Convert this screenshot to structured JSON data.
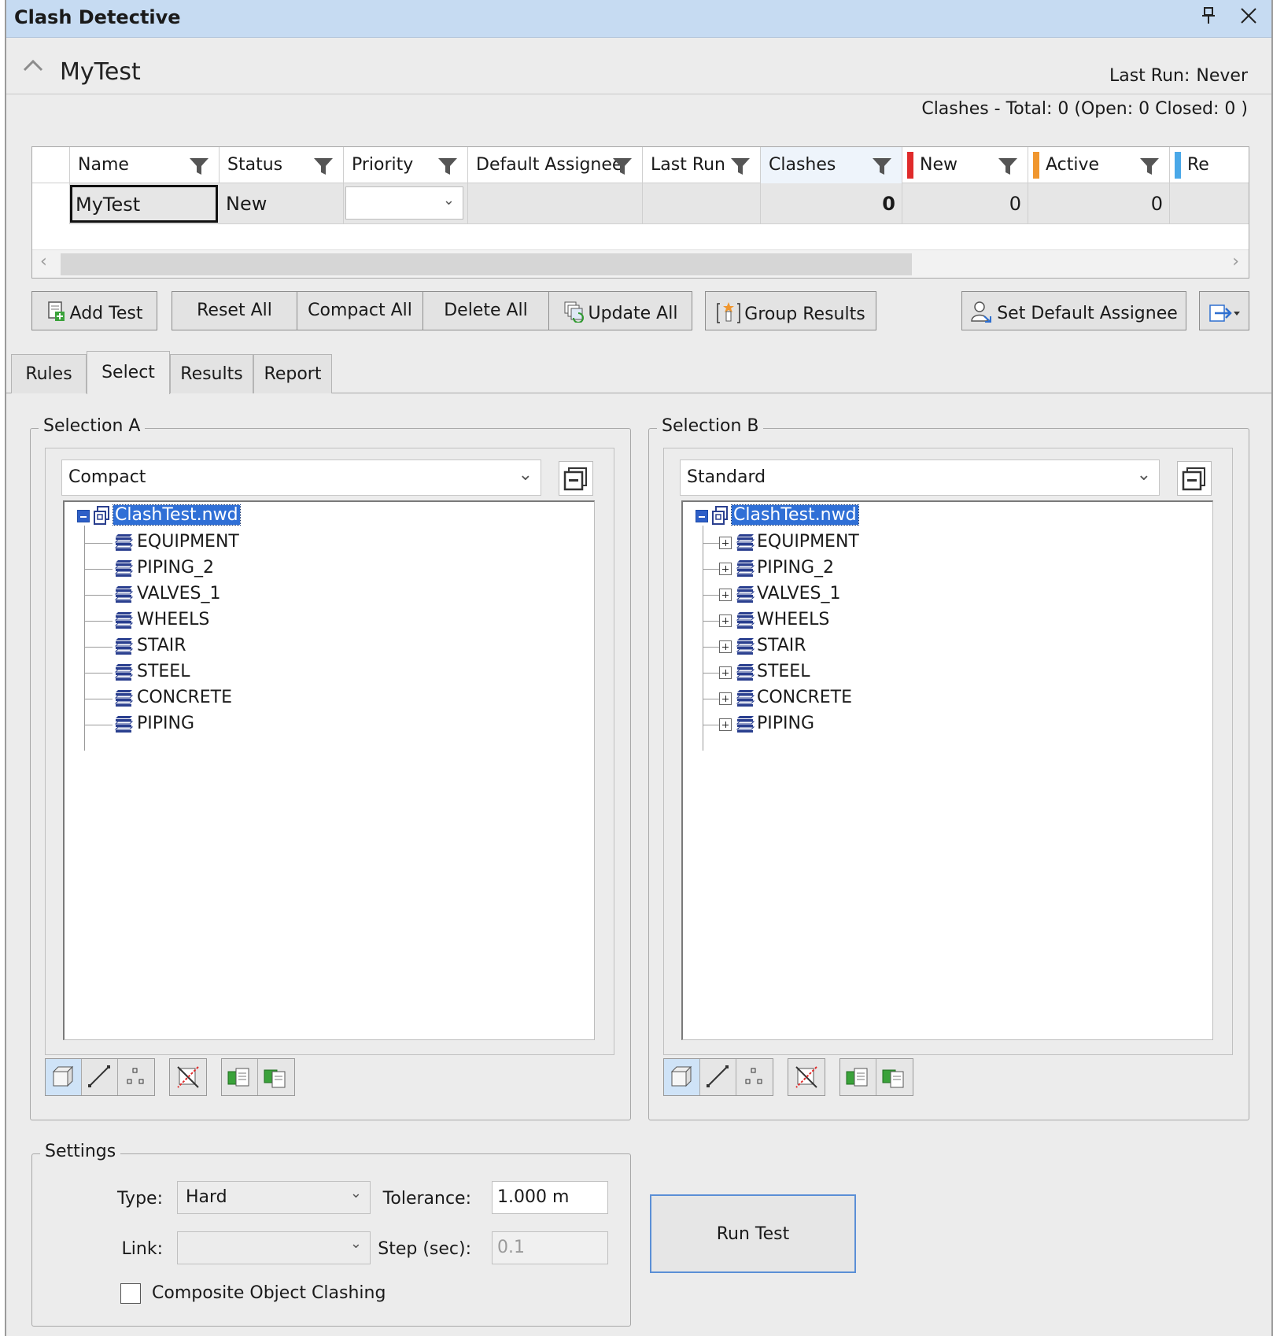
{
  "window": {
    "title": "Clash Detective"
  },
  "test_header": {
    "name": "MyTest",
    "last_run_label": "Last Run:",
    "last_run_value": "Never",
    "summary": "Clashes -  Total:  0  (Open:  0  Closed:  0 )"
  },
  "grid": {
    "columns": [
      "Name",
      "Status",
      "Priority",
      "Default Assignee",
      "Last Run",
      "Clashes",
      "New",
      "Active",
      "Re"
    ],
    "row": {
      "name": "MyTest",
      "status": "New",
      "priority": "",
      "default_assignee": "",
      "last_run": "",
      "clashes": "0",
      "new": "0",
      "active": "0"
    }
  },
  "toolbar": {
    "add_test": "Add Test",
    "reset_all": "Reset All",
    "compact_all": "Compact All",
    "delete_all": "Delete All",
    "update_all": "Update All",
    "group_results": "Group Results",
    "set_default_assignee": "Set Default Assignee"
  },
  "tabs": [
    "Rules",
    "Select",
    "Results",
    "Report"
  ],
  "selection_a": {
    "legend": "Selection A",
    "mode": "Compact",
    "root": "ClashTest.nwd",
    "items": [
      "EQUIPMENT",
      "PIPING_2",
      "VALVES_1",
      "WHEELS",
      "STAIR",
      "STEEL",
      "CONCRETE",
      "PIPING"
    ]
  },
  "selection_b": {
    "legend": "Selection B",
    "mode": "Standard",
    "root": "ClashTest.nwd",
    "items": [
      "EQUIPMENT",
      "PIPING_2",
      "VALVES_1",
      "WHEELS",
      "STAIR",
      "STEEL",
      "CONCRETE",
      "PIPING"
    ]
  },
  "settings": {
    "legend": "Settings",
    "type_label": "Type:",
    "type_value": "Hard",
    "tolerance_label": "Tolerance:",
    "tolerance_value": "1.000 m",
    "link_label": "Link:",
    "link_value": "",
    "step_label": "Step (sec):",
    "step_value": "0.1",
    "composite_label": "Composite Object Clashing",
    "run_test": "Run Test"
  },
  "colors": {
    "new": "#e02b2b",
    "active": "#f0962e",
    "reviewed": "#4aa8e8",
    "selection": "#2f6fd6",
    "titlebar": "#c6dbf2"
  }
}
